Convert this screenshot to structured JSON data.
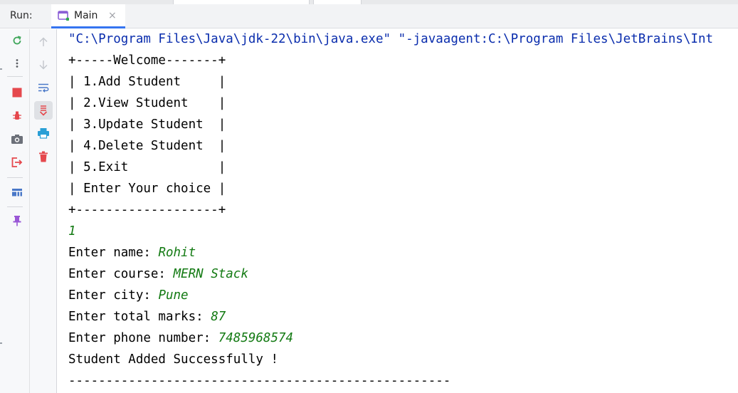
{
  "header": {
    "run_label": "Run:",
    "tab_label": "Main",
    "tab_close": "×"
  },
  "toolbar": {
    "left": [
      {
        "name": "rerun-icon"
      },
      {
        "name": "more-options-icon"
      },
      {
        "name": "stop-icon"
      },
      {
        "name": "debug-bug-icon"
      },
      {
        "name": "screenshot-camera-icon"
      },
      {
        "name": "exit-icon"
      },
      {
        "name": "layout-icon"
      },
      {
        "name": "pin-icon"
      }
    ],
    "right": [
      {
        "name": "scroll-up-icon"
      },
      {
        "name": "scroll-down-icon"
      },
      {
        "name": "soft-wrap-icon"
      },
      {
        "name": "scroll-to-end-icon"
      },
      {
        "name": "print-icon"
      },
      {
        "name": "clear-all-icon"
      }
    ]
  },
  "colors": {
    "command": "#0a2dad",
    "user_input": "#137a13",
    "stop": "#e5484d",
    "accent": "#3574f0"
  },
  "console": {
    "command_line": "\"C:\\Program Files\\Java\\jdk-22\\bin\\java.exe\" \"-javaagent:C:\\Program Files\\JetBrains\\Int",
    "menu": [
      "+-----Welcome-------+",
      "| 1.Add Student     |",
      "| 2.View Student    |",
      "| 3.Update Student  |",
      "| 4.Delete Student  |",
      "| 5.Exit            |",
      "| Enter Your choice |",
      "+-------------------+"
    ],
    "choice": "1",
    "prompts": [
      {
        "label": "Enter name: ",
        "value": "Rohit"
      },
      {
        "label": "Enter course: ",
        "value": "MERN Stack"
      },
      {
        "label": "Enter city: ",
        "value": "Pune"
      },
      {
        "label": "Enter total marks: ",
        "value": "87"
      },
      {
        "label": "Enter phone number: ",
        "value": "7485968574"
      }
    ],
    "success": "Student Added Successfully !",
    "divider": "---------------------------------------------------"
  }
}
